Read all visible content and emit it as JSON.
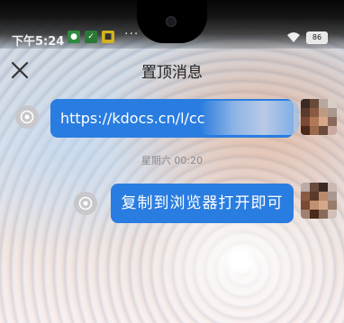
{
  "status_bar": {
    "time": "下午5:24",
    "overflow_dots": "···",
    "battery_level": "86",
    "notification_icons": [
      "app-icon-green",
      "app-icon-green-check",
      "app-icon-yellow"
    ]
  },
  "nav": {
    "title": "置顶消息",
    "close_icon": "close-icon"
  },
  "messages": [
    {
      "type": "link",
      "text": "https://kdocs.cn/l/cc",
      "sender": "self",
      "avatar_blurred": true
    },
    {
      "type": "timestamp",
      "text": "星期六 00:20"
    },
    {
      "type": "text",
      "text": "复制到浏览器打开即可",
      "sender": "self",
      "avatar_blurred": true
    }
  ],
  "colors": {
    "bubble_blue": "#2a7de0",
    "title_text": "#222222",
    "timestamp_text": "#8a8a90"
  }
}
